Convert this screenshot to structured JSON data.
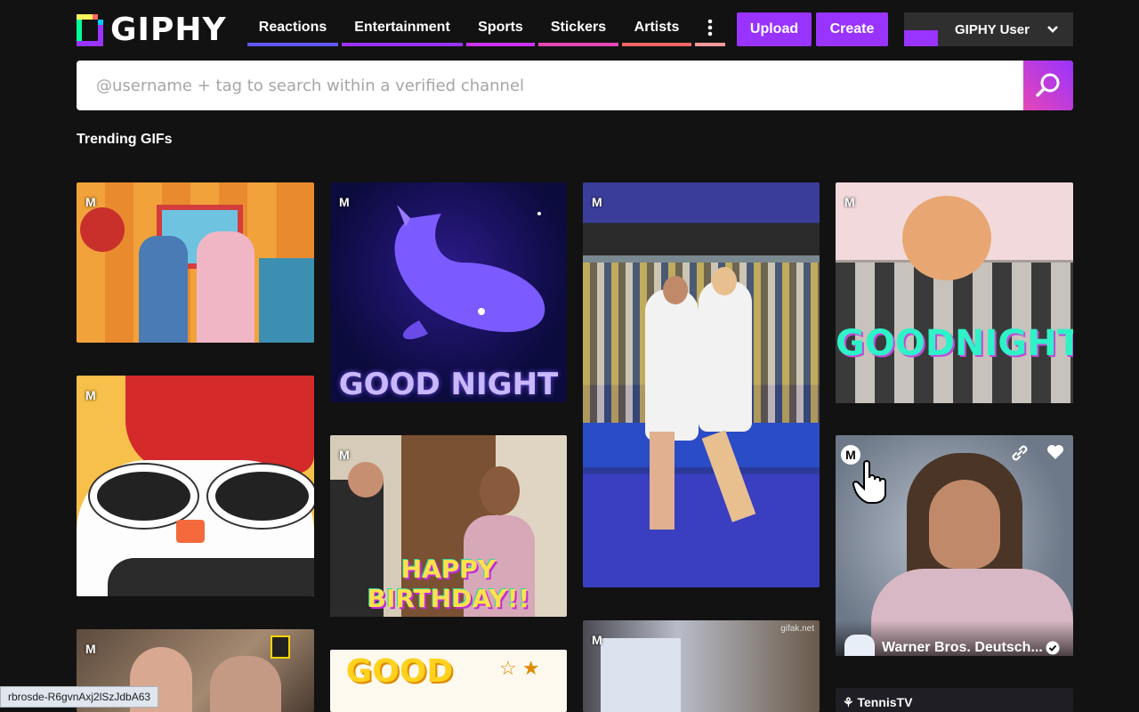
{
  "brand": {
    "name": "GIPHY"
  },
  "nav": [
    {
      "label": "Reactions",
      "color": "#6157ff"
    },
    {
      "label": "Entertainment",
      "color": "#9933ff"
    },
    {
      "label": "Sports",
      "color": "#cc33ff"
    },
    {
      "label": "Stickers",
      "color": "#e646b6"
    },
    {
      "label": "Artists",
      "color": "#ff6666"
    }
  ],
  "more_icon": "more-vertical-icon",
  "buttons": {
    "upload": "Upload",
    "create": "Create"
  },
  "user": {
    "name": "GIPHY User",
    "chevron": "chevron-down-icon"
  },
  "search": {
    "placeholder": "@username + tag to search within a verified channel",
    "icon": "search-icon"
  },
  "section": {
    "title": "Trending GIFs"
  },
  "gifs": [
    {
      "badge": "M",
      "caption": ""
    },
    {
      "badge": "M",
      "caption": ""
    },
    {
      "badge": "M",
      "caption": ""
    },
    {
      "badge": "M",
      "caption": "GOOD NIGHT"
    },
    {
      "badge": "M",
      "caption": "HAPPY BIRTHDAY!!"
    },
    {
      "badge": "M",
      "caption": ""
    },
    {
      "badge": "M",
      "caption": ""
    },
    {
      "badge": "M",
      "caption": ""
    },
    {
      "badge": "M",
      "caption": "GOODNIGHT!"
    },
    {
      "badge": "M",
      "caption": "",
      "channel": "Warner Bros. Deutsch...",
      "verified": true
    },
    {
      "badge": "",
      "caption": "",
      "channel": "TennisTV"
    },
    {
      "badge": "",
      "caption": "GOOD"
    }
  ],
  "watermark": "gifak.net",
  "status_url": "rbrosde-R6gvnAxj2lSzJdbA63",
  "colors": {
    "accent": "#9933ff",
    "background": "#121212"
  }
}
